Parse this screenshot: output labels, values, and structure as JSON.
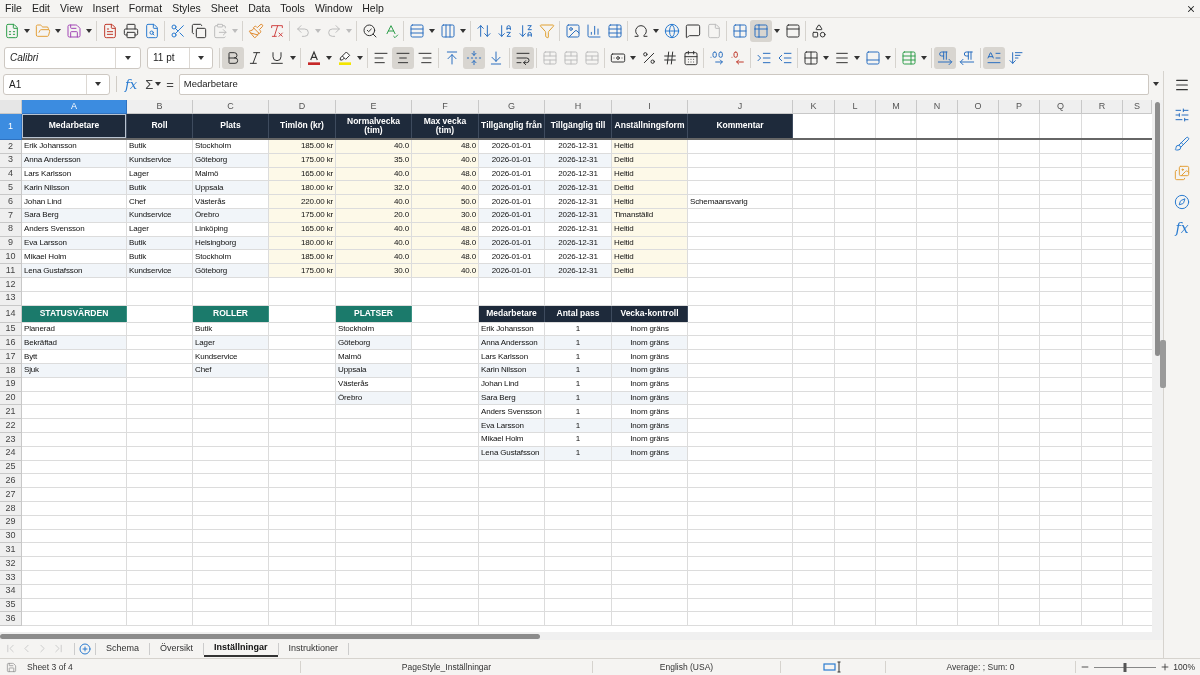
{
  "menu_bar": {
    "items": [
      "File",
      "Edit",
      "View",
      "Insert",
      "Format",
      "Styles",
      "Sheet",
      "Data",
      "Tools",
      "Window",
      "Help"
    ]
  },
  "standard_toolbar": {
    "paste_enabled": false,
    "undo_enabled": false,
    "redo_enabled": false,
    "headers_footers_enabled": false,
    "freeze_active": true
  },
  "formatting_toolbar": {
    "font_name": "Calibri",
    "font_size": "11 pt",
    "bold": true,
    "italic": false,
    "underline": false,
    "align_left": false,
    "align_center": true,
    "align_right": false,
    "align_top": false,
    "align_middle": true,
    "align_bottom": false,
    "wrap_text": true,
    "merge_enabled": false,
    "left_to_right": true,
    "right_to_left": false,
    "text_horizontal": true,
    "text_vertical": false
  },
  "formula_bar": {
    "name_box": "A1",
    "function_wizard": "fx",
    "sum": "Σ",
    "equals": "=",
    "content": "Medarbetare"
  },
  "sheet": {
    "columns": [
      {
        "label": "A",
        "selected": true
      },
      {
        "label": "B",
        "selected": false
      },
      {
        "label": "C",
        "selected": false
      },
      {
        "label": "D",
        "selected": false
      },
      {
        "label": "E",
        "selected": false
      },
      {
        "label": "F",
        "selected": false
      },
      {
        "label": "G",
        "selected": false
      },
      {
        "label": "H",
        "selected": false
      },
      {
        "label": "I",
        "selected": false
      },
      {
        "label": "J",
        "selected": false
      },
      {
        "label": "K",
        "selected": false
      },
      {
        "label": "L",
        "selected": false
      },
      {
        "label": "M",
        "selected": false
      },
      {
        "label": "N",
        "selected": false
      },
      {
        "label": "O",
        "selected": false
      },
      {
        "label": "P",
        "selected": false
      },
      {
        "label": "Q",
        "selected": false
      },
      {
        "label": "R",
        "selected": false
      },
      {
        "label": "S",
        "selected": false
      }
    ],
    "rows": [
      {
        "label": "1",
        "selected": true
      },
      {
        "label": "2",
        "selected": false
      },
      {
        "label": "3",
        "selected": false
      },
      {
        "label": "4",
        "selected": false
      },
      {
        "label": "5",
        "selected": false
      },
      {
        "label": "6",
        "selected": false
      },
      {
        "label": "7",
        "selected": false
      },
      {
        "label": "8",
        "selected": false
      },
      {
        "label": "9",
        "selected": false
      },
      {
        "label": "10",
        "selected": false
      },
      {
        "label": "11",
        "selected": false
      },
      {
        "label": "12",
        "selected": false
      },
      {
        "label": "13",
        "selected": false
      },
      {
        "label": "14",
        "selected": false
      },
      {
        "label": "15",
        "selected": false
      },
      {
        "label": "16",
        "selected": false
      },
      {
        "label": "17",
        "selected": false
      },
      {
        "label": "18",
        "selected": false
      },
      {
        "label": "19",
        "selected": false
      },
      {
        "label": "20",
        "selected": false
      },
      {
        "label": "21",
        "selected": false
      },
      {
        "label": "22",
        "selected": false
      },
      {
        "label": "23",
        "selected": false
      },
      {
        "label": "24",
        "selected": false
      },
      {
        "label": "25",
        "selected": false
      },
      {
        "label": "26",
        "selected": false
      },
      {
        "label": "27",
        "selected": false
      },
      {
        "label": "28",
        "selected": false
      },
      {
        "label": "29",
        "selected": false
      },
      {
        "label": "30",
        "selected": false
      },
      {
        "label": "31",
        "selected": false
      },
      {
        "label": "32",
        "selected": false
      },
      {
        "label": "33",
        "selected": false
      },
      {
        "label": "34",
        "selected": false
      },
      {
        "label": "35",
        "selected": false
      },
      {
        "label": "36",
        "selected": false
      }
    ],
    "employee_table": {
      "columns": [
        "Medarbetare",
        "Roll",
        "Plats",
        "Timlön (kr)",
        "Normalvecka (tim)",
        "Max vecka (tim)",
        "Tillgänglig från",
        "Tillgänglig till",
        "Anställningsform",
        "Kommentar"
      ],
      "rows": [
        {
          "name": "Erik Johansson",
          "role": "Butik",
          "location": "Stockholm",
          "hourly_wage": "185.00 kr",
          "normal_week": "40.0",
          "max_week": "48.0",
          "available_from": "2026-01-01",
          "available_to": "2026-12-31",
          "employment_type": "Heltid"
        },
        {
          "name": "Anna Andersson",
          "role": "Kundservice",
          "location": "Göteborg",
          "hourly_wage": "175.00 kr",
          "normal_week": "35.0",
          "max_week": "40.0",
          "available_from": "2026-01-01",
          "available_to": "2026-12-31",
          "employment_type": "Deltid"
        },
        {
          "name": "Lars Karlsson",
          "role": "Lager",
          "location": "Malmö",
          "hourly_wage": "165.00 kr",
          "normal_week": "40.0",
          "max_week": "48.0",
          "available_from": "2026-01-01",
          "available_to": "2026-12-31",
          "employment_type": "Heltid"
        },
        {
          "name": "Karin Nilsson",
          "role": "Butik",
          "location": "Uppsala",
          "hourly_wage": "180.00 kr",
          "normal_week": "32.0",
          "max_week": "40.0",
          "available_from": "2026-01-01",
          "available_to": "2026-12-31",
          "employment_type": "Deltid"
        },
        {
          "name": "Johan Lind",
          "role": "Chef",
          "location": "Västerås",
          "hourly_wage": "220.00 kr",
          "normal_week": "40.0",
          "max_week": "50.0",
          "available_from": "2026-01-01",
          "available_to": "2026-12-31",
          "employment_type": "Heltid",
          "comment": "Schemaansvarig"
        },
        {
          "name": "Sara Berg",
          "role": "Kundservice",
          "location": "Örebro",
          "hourly_wage": "175.00 kr",
          "normal_week": "20.0",
          "max_week": "30.0",
          "available_from": "2026-01-01",
          "available_to": "2026-12-31",
          "employment_type": "Timanställd"
        },
        {
          "name": "Anders Svensson",
          "role": "Lager",
          "location": "Linköping",
          "hourly_wage": "165.00 kr",
          "normal_week": "40.0",
          "max_week": "48.0",
          "available_from": "2026-01-01",
          "available_to": "2026-12-31",
          "employment_type": "Heltid"
        },
        {
          "name": "Eva Larsson",
          "role": "Butik",
          "location": "Helsingborg",
          "hourly_wage": "180.00 kr",
          "normal_week": "40.0",
          "max_week": "48.0",
          "available_from": "2026-01-01",
          "available_to": "2026-12-31",
          "employment_type": "Heltid"
        },
        {
          "name": "Mikael Holm",
          "role": "Butik",
          "location": "Stockholm",
          "hourly_wage": "185.00 kr",
          "normal_week": "40.0",
          "max_week": "48.0",
          "available_from": "2026-01-01",
          "available_to": "2026-12-31",
          "employment_type": "Heltid"
        },
        {
          "name": "Lena Gustafsson",
          "role": "Kundservice",
          "location": "Göteborg",
          "hourly_wage": "175.00 kr",
          "normal_week": "30.0",
          "max_week": "40.0",
          "available_from": "2026-01-01",
          "available_to": "2026-12-31",
          "employment_type": "Deltid"
        }
      ]
    },
    "status_values": {
      "header": "STATUSVÄRDEN",
      "items": [
        "Planerad",
        "Bekräftad",
        "Bytt",
        "Sjuk"
      ]
    },
    "roles": {
      "header": "ROLLER",
      "items": [
        "Butik",
        "Lager",
        "Kundservice",
        "Chef"
      ]
    },
    "locations": {
      "header": "PLATSER",
      "items": [
        "Stockholm",
        "Göteborg",
        "Malmö",
        "Uppsala",
        "Västerås",
        "Örebro"
      ]
    },
    "shift_check": {
      "columns": [
        "Medarbetare",
        "Antal pass",
        "Vecka-kontroll"
      ],
      "rows": [
        {
          "employee": "Erik Johansson",
          "shift_count": "1",
          "week_check": "Inom gräns"
        },
        {
          "employee": "Anna Andersson",
          "shift_count": "1",
          "week_check": "Inom gräns"
        },
        {
          "employee": "Lars Karlsson",
          "shift_count": "1",
          "week_check": "Inom gräns"
        },
        {
          "employee": "Karin Nilsson",
          "shift_count": "1",
          "week_check": "Inom gräns"
        },
        {
          "employee": "Johan Lind",
          "shift_count": "1",
          "week_check": "Inom gräns"
        },
        {
          "employee": "Sara Berg",
          "shift_count": "1",
          "week_check": "Inom gräns"
        },
        {
          "employee": "Anders Svensson",
          "shift_count": "1",
          "week_check": "Inom gräns"
        },
        {
          "employee": "Eva Larsson",
          "shift_count": "1",
          "week_check": "Inom gräns"
        },
        {
          "employee": "Mikael Holm",
          "shift_count": "1",
          "week_check": "Inom gräns"
        },
        {
          "employee": "Lena Gustafsson",
          "shift_count": "1",
          "week_check": "Inom gräns"
        }
      ]
    }
  },
  "sheet_tabs": [
    {
      "label": "Schema",
      "selected": false
    },
    {
      "label": "Översikt",
      "selected": false
    },
    {
      "label": "Inställningar",
      "selected": true
    },
    {
      "label": "Instruktioner",
      "selected": false
    }
  ],
  "sidebar": {
    "functions": "fx"
  },
  "status_bar": {
    "sheet": "Sheet 3 of 4",
    "page_style": "PageStyle_Inställningar",
    "language": "English (USA)",
    "selection_summary": "Average: ; Sum: 0",
    "zoom": {
      "level": 0.5,
      "reading": "100%"
    }
  }
}
